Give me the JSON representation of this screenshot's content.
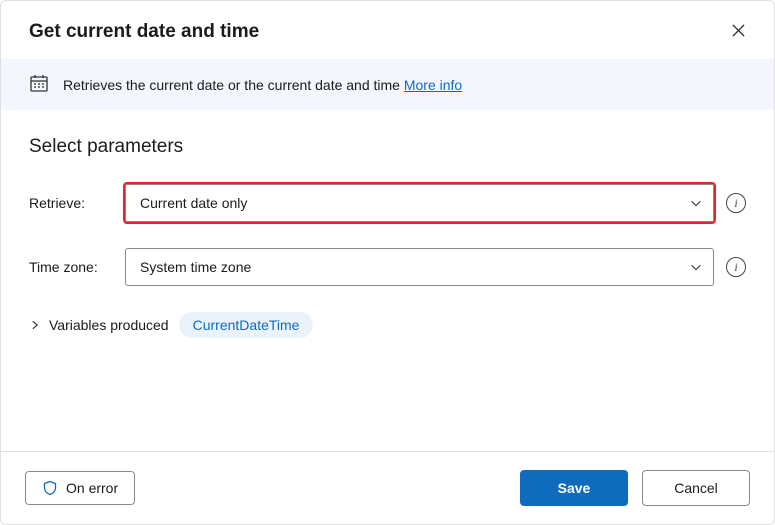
{
  "dialog": {
    "title": "Get current date and time"
  },
  "info": {
    "text": "Retrieves the current date or the current date and time ",
    "link_label": "More info"
  },
  "section": {
    "title": "Select parameters"
  },
  "params": {
    "retrieve": {
      "label": "Retrieve:",
      "value": "Current date only"
    },
    "timezone": {
      "label": "Time zone:",
      "value": "System time zone"
    }
  },
  "vars": {
    "label": "Variables produced",
    "chip": "CurrentDateTime"
  },
  "footer": {
    "on_error": "On error",
    "save": "Save",
    "cancel": "Cancel"
  }
}
